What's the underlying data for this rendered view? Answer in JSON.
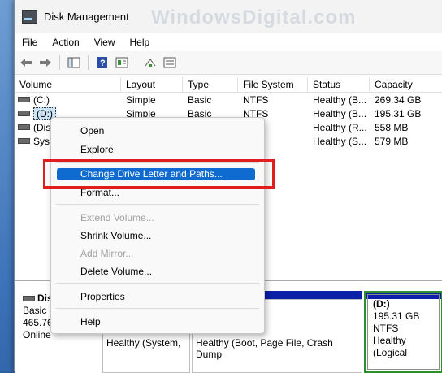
{
  "window": {
    "title": "Disk Management",
    "watermark": "WindowsDigital.com"
  },
  "menu": [
    "File",
    "Action",
    "View",
    "Help"
  ],
  "toolbar": {
    "icons": [
      "back-arrow-icon",
      "forward-arrow-icon",
      "console-tree-icon",
      "help-icon",
      "properties-icon",
      "rescan-icon",
      "list-icon"
    ]
  },
  "table": {
    "columns": [
      "Volume",
      "Layout",
      "Type",
      "File System",
      "Status",
      "Capacity"
    ],
    "rows": [
      {
        "volume": "(C:)",
        "layout": "Simple",
        "type": "Basic",
        "fs": "NTFS",
        "status": "Healthy (B...",
        "capacity": "269.34 GB"
      },
      {
        "volume": "(D:)",
        "layout": "Simple",
        "type": "Basic",
        "fs": "NTFS",
        "status": "Healthy (B...",
        "capacity": "195.31 GB"
      },
      {
        "volume": "(Dis",
        "layout": "",
        "type": "",
        "fs": "",
        "status": "Healthy (R...",
        "capacity": "558 MB"
      },
      {
        "volume": "Syst",
        "layout": "",
        "type": "",
        "fs": "",
        "status": "Healthy (S...",
        "capacity": "579 MB"
      }
    ]
  },
  "disk": {
    "name": "Dis",
    "type": "Basic",
    "size": "465.76",
    "state": "Online",
    "partitions": {
      "system": "Healthy (System,",
      "boot": "Healthy (Boot, Page File, Crash Dump",
      "d_label": "(D:)",
      "d_size": "195.31 GB NTFS",
      "d_status": "Healthy (Logical"
    }
  },
  "context_menu": {
    "open": "Open",
    "explore": "Explore",
    "change_drive_letter": "Change Drive Letter and Paths...",
    "format": "Format...",
    "extend": "Extend Volume...",
    "shrink": "Shrink Volume...",
    "add_mirror": "Add Mirror...",
    "delete": "Delete Volume...",
    "properties": "Properties",
    "help": "Help"
  },
  "colors": {
    "highlight": "#0f6bd0",
    "annotation_box": "#e11d1d",
    "partition_bar": "#0b1fa8",
    "selected_partition_border": "#2f8f2f"
  }
}
